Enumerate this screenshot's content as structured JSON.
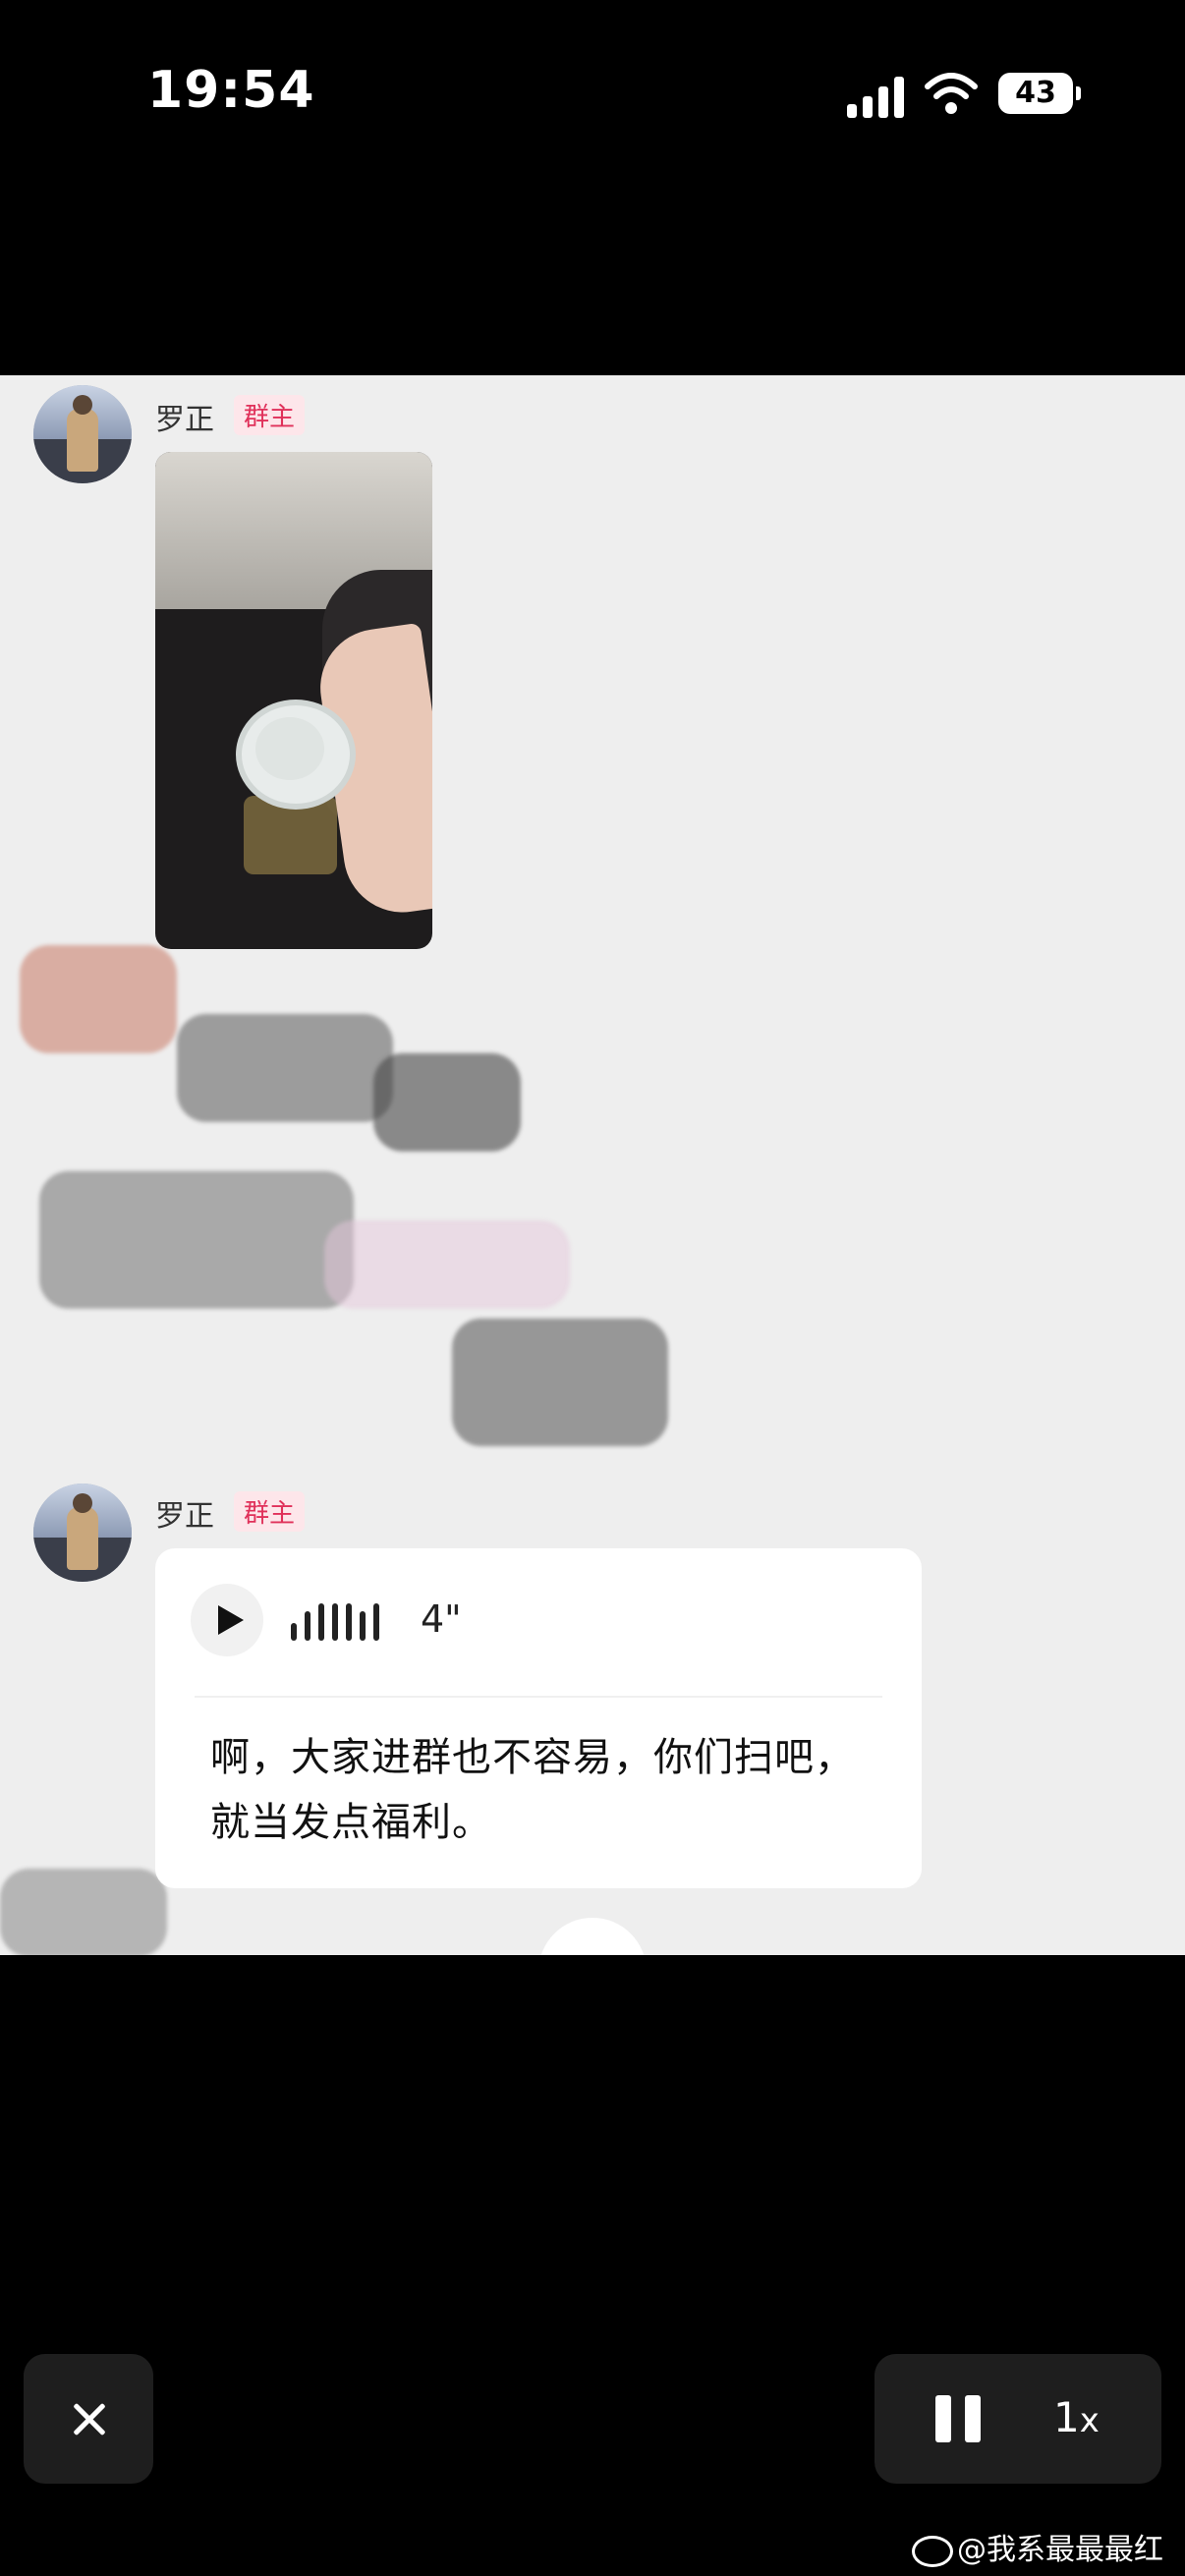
{
  "status_bar": {
    "time": "19:54",
    "battery": "43",
    "icons": [
      "signal-icon",
      "wifi-icon",
      "battery-icon"
    ]
  },
  "chat": {
    "messages": [
      {
        "sender": "罗正",
        "badge": "群主",
        "type": "image"
      },
      {
        "sender": "罗正",
        "badge": "群主",
        "type": "voice",
        "duration": "4\"",
        "transcript": "啊，大家进群也不容易，你们扫吧，就当发点福利。"
      }
    ]
  },
  "player": {
    "speed": "1",
    "speed_unit": "x",
    "icons": [
      "close-icon",
      "pause-icon"
    ]
  },
  "watermark": "@我系最最最红"
}
